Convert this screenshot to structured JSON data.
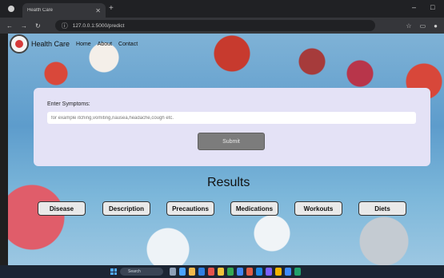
{
  "browser": {
    "tab_title": "Health Care",
    "address": "127.0.0.1:5000/predict"
  },
  "nav": {
    "brand": "Health Care",
    "links": [
      "Home",
      "About",
      "Contact"
    ]
  },
  "form": {
    "label": "Enter Symptoms:",
    "input_value": "",
    "placeholder": "for example itching,vomiting,nausea,headache,cough etc.",
    "submit_label": "Submit"
  },
  "results": {
    "heading": "Results",
    "buttons": [
      "Disease",
      "Description",
      "Precautions",
      "Medications",
      "Workouts",
      "Diets"
    ]
  },
  "taskbar": {
    "search": "Search"
  }
}
